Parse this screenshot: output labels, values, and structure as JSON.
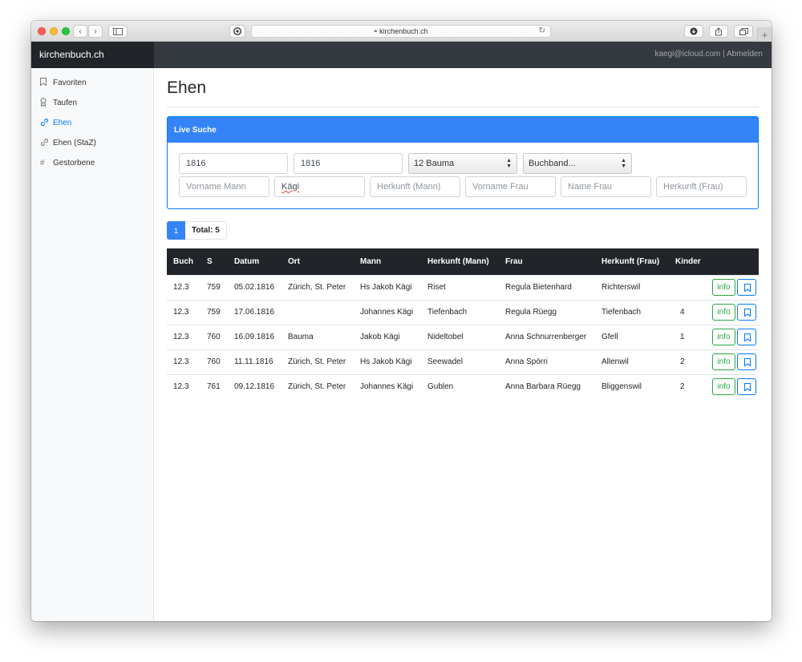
{
  "browser": {
    "url": "kirchenbuch.ch"
  },
  "navbar": {
    "brand": "kirchenbuch.ch",
    "user_email": "kaegi@icloud.com",
    "separator": " | ",
    "logout": "Abmelden"
  },
  "sidebar": {
    "items": [
      {
        "label": "Favoriten",
        "icon": "bookmark-icon",
        "active": false
      },
      {
        "label": "Taufen",
        "icon": "award-icon",
        "active": false
      },
      {
        "label": "Ehen",
        "icon": "link-icon",
        "active": true
      },
      {
        "label": "Ehen (StaZ)",
        "icon": "link-icon",
        "active": false
      },
      {
        "label": "Gestorbene",
        "icon": "hash-icon",
        "active": false
      }
    ]
  },
  "main": {
    "title": "Ehen",
    "search": {
      "header": "Live Suche",
      "year_from": "1816",
      "year_to": "1816",
      "ort_select": "12 Bauma",
      "buchband_select": "Buchband...",
      "vorname_mann_placeholder": "Vorname Mann",
      "name_mann_value": "Kägi",
      "herkunft_mann_placeholder": "Herkunft (Mann)",
      "vorname_frau_placeholder": "Vorname Frau",
      "name_frau_placeholder": "Name Frau",
      "herkunft_frau_placeholder": "Herkunft (Frau)"
    },
    "pagination": {
      "page": "1",
      "total": "Total: 5"
    },
    "table": {
      "headers": [
        "Buch",
        "S",
        "Datum",
        "Ort",
        "Mann",
        "Herkunft (Mann)",
        "Frau",
        "Herkunft (Frau)",
        "Kinder"
      ],
      "info_label": "info",
      "rows": [
        {
          "buch": "12.3",
          "s": "759",
          "datum": "05.02.1816",
          "ort": "Zürich, St. Peter",
          "mann": "Hs Jakob Kägi",
          "herkunft_mann": "Riset",
          "frau": "Regula Bietenhard",
          "herkunft_frau": "Richterswil",
          "kinder": ""
        },
        {
          "buch": "12.3",
          "s": "759",
          "datum": "17.06.1816",
          "ort": "",
          "mann": "Johannes Kägi",
          "herkunft_mann": "Tiefenbach",
          "frau": "Regula Rüegg",
          "herkunft_frau": "Tiefenbach",
          "kinder": "4"
        },
        {
          "buch": "12.3",
          "s": "760",
          "datum": "16.09.1816",
          "ort": "Bauma",
          "mann": "Jakob Kägi",
          "herkunft_mann": "Nideltobel",
          "frau": "Anna Schnurrenberger",
          "herkunft_frau": "Gfell",
          "kinder": "1"
        },
        {
          "buch": "12.3",
          "s": "760",
          "datum": "11.11.1816",
          "ort": "Zürich, St. Peter",
          "mann": "Hs Jakob Kägi",
          "herkunft_mann": "Seewadel",
          "frau": "Anna Spörri",
          "herkunft_frau": "Allenwil",
          "kinder": "2"
        },
        {
          "buch": "12.3",
          "s": "761",
          "datum": "09.12.1816",
          "ort": "Zürich, St. Peter",
          "mann": "Johannes Kägi",
          "herkunft_mann": "Gublen",
          "frau": "Anna Barbara Rüegg",
          "herkunft_frau": "Bliggenswil",
          "kinder": "2"
        }
      ]
    }
  },
  "colors": {
    "primary": "#007bff",
    "success": "#28a745",
    "dark": "#343a40"
  }
}
